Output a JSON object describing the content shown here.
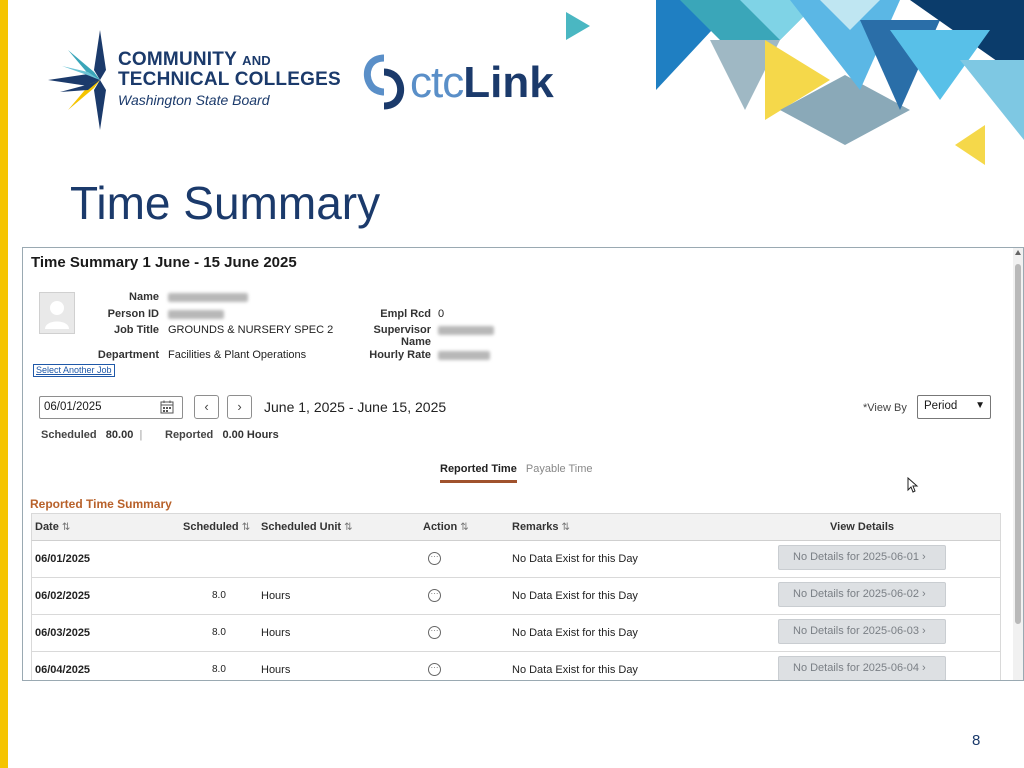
{
  "slide": {
    "title": "Time Summary",
    "page_number": "8",
    "logo_ctc": {
      "line1": "COMMUNITY",
      "line1_and": "AND",
      "line2": "TECHNICAL COLLEGES",
      "line3": "Washington State Board"
    },
    "logo_ctclink": {
      "part1": "ctc",
      "part2": "Link"
    },
    "colors": {
      "title": "#1b3a6b",
      "accent_yellow": "#f5c400",
      "teal": "#3aa6b9",
      "blue": "#1f7fc2"
    }
  },
  "summary": {
    "title": "Time Summary 1 June - 15 June 2025",
    "labels": {
      "name": "Name",
      "person_id": "Person ID",
      "job_title": "Job Title",
      "department": "Department",
      "empl_rcd": "Empl Rcd",
      "supervisor_name": "Supervisor Name",
      "hourly_rate": "Hourly Rate"
    },
    "values": {
      "job_title": "GROUNDS & NURSERY SPEC 2",
      "department": "Facilities & Plant Operations",
      "empl_rcd": "0"
    },
    "select_another_job": "Select Another Job",
    "date_input_value": "06/01/2025",
    "date_range": "June 1, 2025 - June 15, 2025",
    "view_by_label": "*View By",
    "view_by_value": "Period",
    "scheduled_label": "Scheduled",
    "scheduled_value": "80.00",
    "reported_label": "Reported",
    "reported_value": "0.00 Hours",
    "tabs": [
      "Reported Time",
      "Payable Time"
    ],
    "section_title": "Reported Time Summary",
    "columns": [
      "Date",
      "Scheduled",
      "Scheduled Unit",
      "Action",
      "Remarks",
      "View Details"
    ],
    "rows": [
      {
        "date": "06/01/2025",
        "scheduled": "",
        "unit": "",
        "remarks": "No Data Exist for this Day",
        "details": "No Details for 2025-06-01"
      },
      {
        "date": "06/02/2025",
        "scheduled": "8.0",
        "unit": "Hours",
        "remarks": "No Data Exist for this Day",
        "details": "No Details for 2025-06-02"
      },
      {
        "date": "06/03/2025",
        "scheduled": "8.0",
        "unit": "Hours",
        "remarks": "No Data Exist for this Day",
        "details": "No Details for 2025-06-03"
      },
      {
        "date": "06/04/2025",
        "scheduled": "8.0",
        "unit": "Hours",
        "remarks": "No Data Exist for this Day",
        "details": "No Details for 2025-06-04"
      }
    ]
  }
}
